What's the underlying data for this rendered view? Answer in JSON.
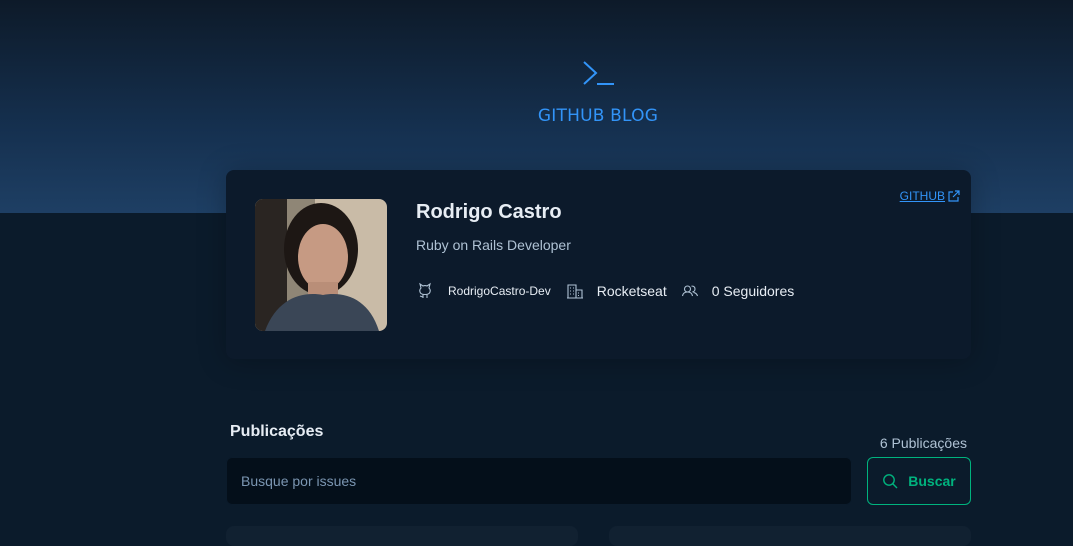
{
  "header": {
    "title": "GITHUB BLOG",
    "logo_icon": "terminal-prompt-icon",
    "accent_color": "#3294f8"
  },
  "profile": {
    "name": "Rodrigo Castro",
    "bio": "Ruby on Rails Developer",
    "github_link_label": "GITHUB",
    "username": "RodrigoCastro-Dev",
    "company": "Rocketseat",
    "followers": "0 Seguidores"
  },
  "publications": {
    "title": "Publicações",
    "count_label": "6 Publicações",
    "search_placeholder": "Busque por issues",
    "search_button_label": "Buscar",
    "button_color": "#00b37e"
  }
}
